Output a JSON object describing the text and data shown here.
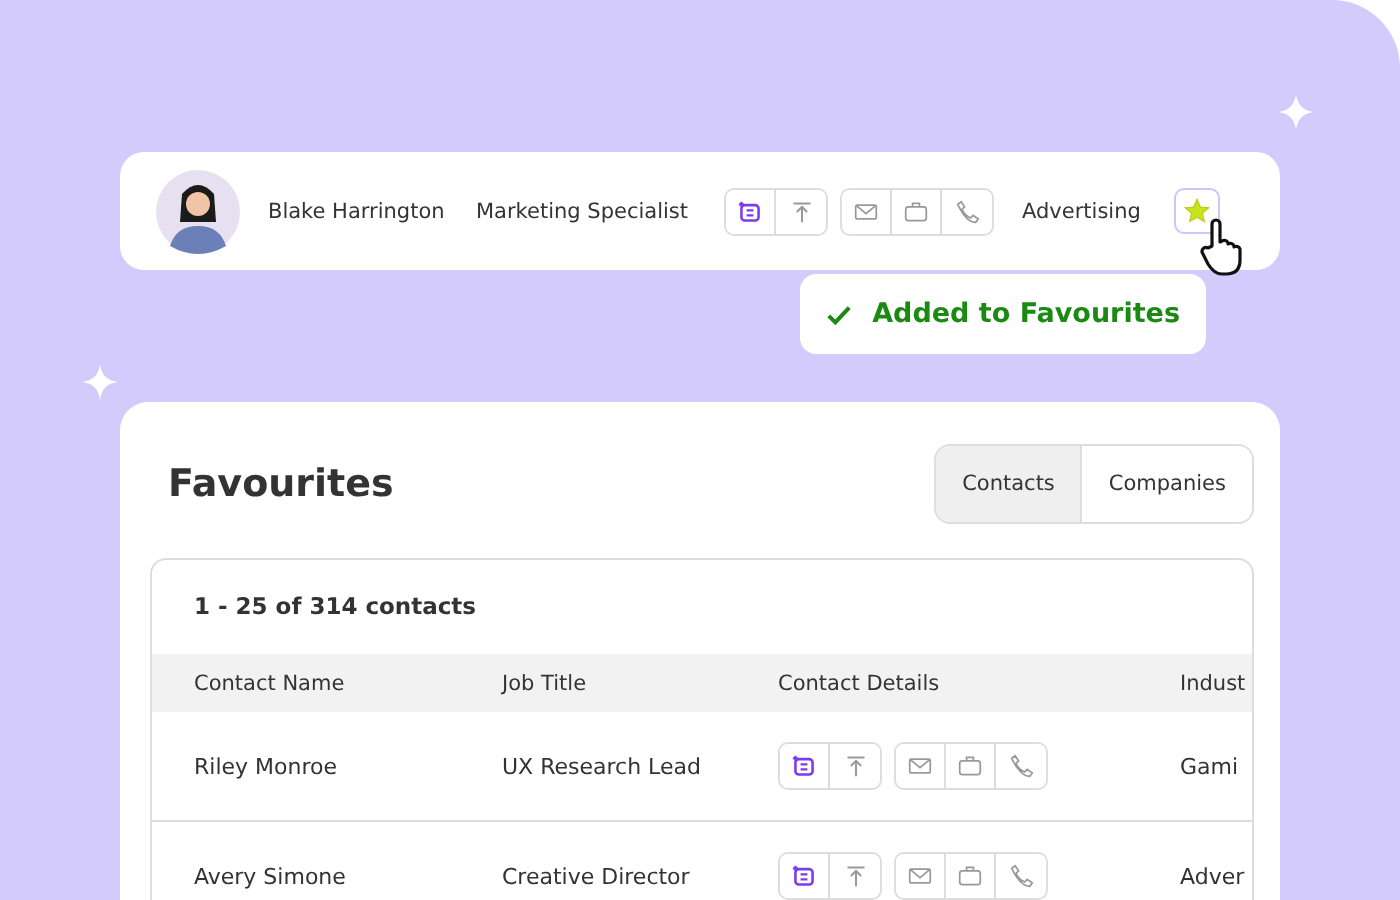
{
  "profile_card": {
    "name": "Blake Harrington",
    "job_title": "Marketing Specialist",
    "industry": "Advertising",
    "favourite": true
  },
  "toast": {
    "message": "Added to Favourites"
  },
  "panel": {
    "title": "Favourites",
    "tabs": [
      {
        "label": "Contacts",
        "selected": true
      },
      {
        "label": "Companies",
        "selected": false
      }
    ]
  },
  "table": {
    "count": "1 - 25 of 314 contacts",
    "columns": [
      "Contact Name",
      "Job Title",
      "Contact Details",
      "Indust"
    ],
    "rows": [
      {
        "name": "Riley Monroe",
        "job_title": "UX Research Lead",
        "industry": "Gami"
      },
      {
        "name": "Avery Simone",
        "job_title": "Creative Director",
        "industry": "Adver"
      }
    ]
  }
}
